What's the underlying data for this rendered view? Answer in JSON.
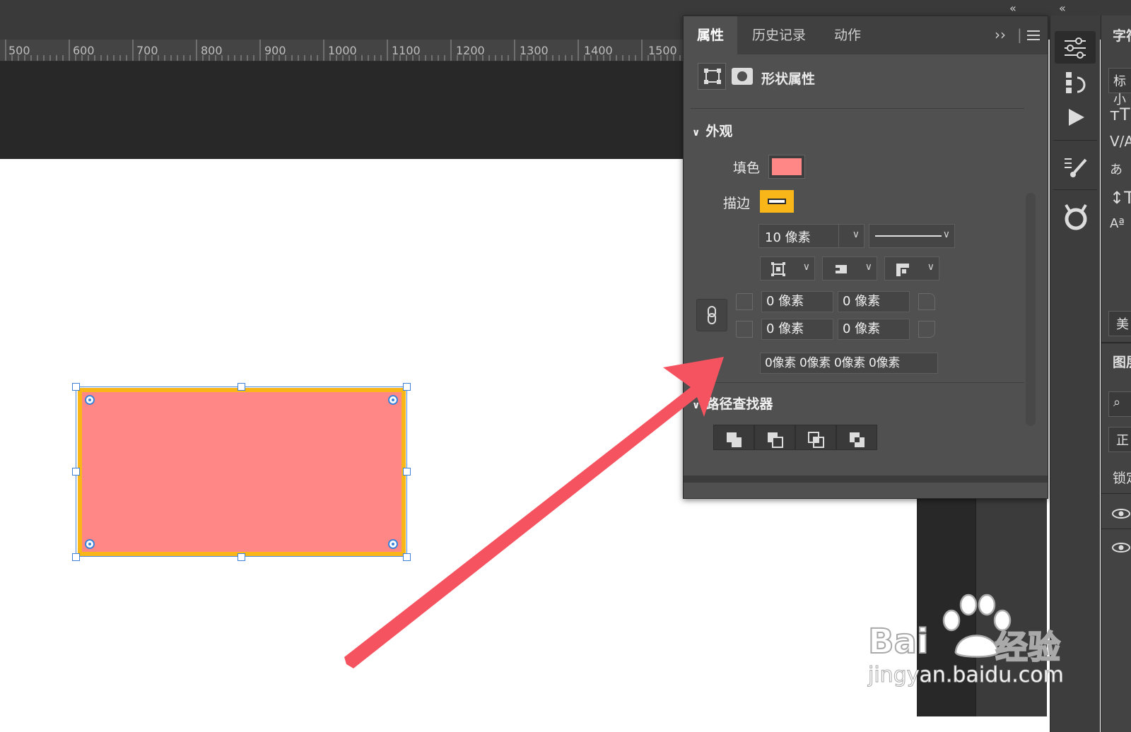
{
  "ruler": {
    "ticks": [
      "500",
      "600",
      "700",
      "800",
      "900",
      "1000",
      "1100",
      "1200",
      "1300",
      "1400",
      "1500"
    ]
  },
  "panel": {
    "tabs": [
      "属性",
      "历史记录",
      "动作"
    ],
    "overflow_icon": "double-chevron-right-icon",
    "menu_icon": "hamburger-menu-icon",
    "title": "形状属性",
    "appearance": {
      "section_label": "外观",
      "fill_label": "填色",
      "fill_color": "#ff8886",
      "stroke_label": "描边",
      "stroke_color": "#f9b618",
      "stroke_width": "10 像素",
      "corner_top_left": "0 像素",
      "corner_top_right": "0 像素",
      "corner_bottom_left": "0 像素",
      "corner_bottom_right": "0 像素",
      "corner_all": "0像素 0像素 0像素 0像素"
    },
    "pathfinder": {
      "section_label": "路径查找器"
    }
  },
  "far_right_panel": {
    "items": [
      "字符",
      "标小",
      "美",
      "图层",
      "正",
      "锁定"
    ]
  },
  "collapse_icons": [
    "«",
    "«"
  ],
  "watermark": {
    "brand": "Bai",
    "brand_cn": "经验",
    "url": "jingyan.baidu.com"
  },
  "colors": {
    "arrow": "#f5535f",
    "selection": "#3d82d9"
  }
}
